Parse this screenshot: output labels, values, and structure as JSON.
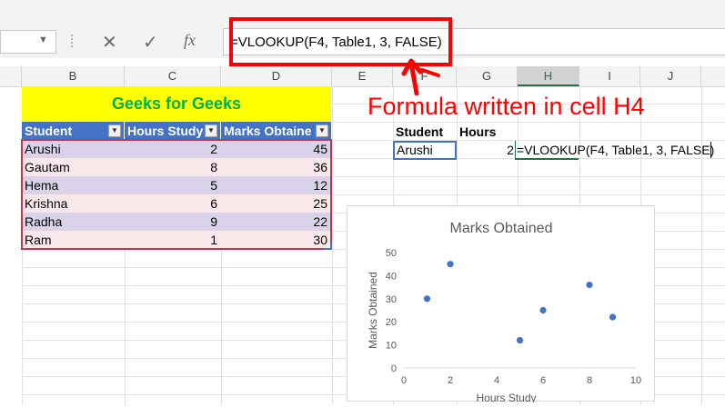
{
  "formula_bar": {
    "cancel_icon": "✕",
    "enter_icon": "✓",
    "fx_label": "fx",
    "formula": "=VLOOKUP(F4, Table1, 3, FALSE)"
  },
  "columns": [
    "B",
    "C",
    "D",
    "E",
    "F",
    "G",
    "H",
    "I",
    "J"
  ],
  "selected_column": "H",
  "sheet": {
    "title": "Geeks for Geeks",
    "title_color": "#00b050",
    "title_fill": "#ffff00",
    "headers": [
      "Student",
      "Hours Study",
      "Marks Obtaine"
    ],
    "header_color": "#4472c4",
    "rows": [
      {
        "student": "Arushi",
        "hours": "2",
        "marks": "45"
      },
      {
        "student": "Gautam",
        "hours": "8",
        "marks": "36"
      },
      {
        "student": "Hema",
        "hours": "5",
        "marks": "12"
      },
      {
        "student": "Krishna",
        "hours": "6",
        "marks": "25"
      },
      {
        "student": "Radha",
        "hours": "9",
        "marks": "22"
      },
      {
        "student": "Ram",
        "hours": "1",
        "marks": "30"
      }
    ],
    "band_colors": [
      "#d9d2e9",
      "#f8e8ea"
    ]
  },
  "lookup": {
    "student_header": "Student",
    "hours_header": "Hours",
    "student_value": "Arushi",
    "hours_value": "2",
    "formula_cell_text": "=VLOOKUP(F4, Table1, 3, FALSE)"
  },
  "annotation": {
    "text": "Formula written in cell H4",
    "color": "#ff0000"
  },
  "chart_data": {
    "type": "scatter",
    "title": "Marks Obtained",
    "xlabel": "Hours Study",
    "ylabel": "Marks Obtained",
    "x": [
      2,
      8,
      5,
      6,
      9,
      1
    ],
    "y": [
      45,
      36,
      12,
      25,
      22,
      30
    ],
    "xlim": [
      0,
      10
    ],
    "ylim": [
      0,
      50
    ],
    "xticks": [
      0,
      2,
      4,
      6,
      8,
      10
    ],
    "yticks": [
      0,
      10,
      20,
      30,
      40,
      50
    ],
    "grid": false,
    "marker_color": "#4472c4"
  }
}
